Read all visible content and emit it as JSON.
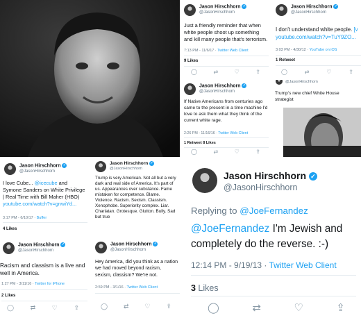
{
  "tweets": {
    "t1": {
      "name": "Jason Hirschhorn",
      "handle": "@JasonHirschhorn",
      "text": "Just a friendly reminder that when white people shoot up something and kill many people that's terrorism.",
      "time": "7:13 PM - 11/6/17 · ",
      "client": "Twitter Web Client",
      "stats": "9 Likes"
    },
    "t2": {
      "name": "Jason Hirschhorn",
      "handle": "@JasonHirschhorn",
      "text": "I don't understand white people. ",
      "link": "[v youtube.com/watch?v=TuY9ZO...",
      "time": "3:03 PM - 4/30/12 · ",
      "client": "YouTube on iOS",
      "stats": "1 Retweet"
    },
    "t3": {
      "name": "Jason Hirschhorn",
      "handle": "@JasonHirschhorn",
      "text": "If Native Americans from centuries ago came to the present in a time machine I'd love to ask them what they think of the current white rage.",
      "time": "2:26 PM - 11/16/16 · ",
      "client": "Twitter Web Client",
      "stats": "1 Retweet 8 Likes"
    },
    "t4": {
      "handle": "@JasonHirschhorn",
      "text": "Trump's new chief White House strategist"
    },
    "t5": {
      "name": "Jason Hirschhorn",
      "handle": "@JasonHirschhorn",
      "text_a": "I love Cube... ",
      "mention": "@icecube",
      "text_b": " and Symone Sanders on White Privilege | Real Time with Bill Maher (HBO) ",
      "link": "youtube.com/watch?v=gnwiYd...",
      "time": "3:17 PM - 6/10/17 · ",
      "client": "Buffer",
      "stats": "4 Likes"
    },
    "t6": {
      "name": "Jason Hirschhorn",
      "handle": "@JasonHirschhorn",
      "text": "Trump is very American. Not all but a very dark and real side of America. It's part of us. Appearances over substance. Fame mistaken for competence. Blame. Violence. Racism. Sexism. Classism. Xenophobe. Superiority complex. Liar. Charlatan. Grotesque. Glutton. Bully. Sad but true"
    },
    "t7": {
      "name": "Jason Hirschhorn",
      "handle": "@JasonHirschhorn",
      "text": "Racism and classism is a live and well in America.",
      "time": "1:27 PM - 3/11/16 · ",
      "client": "Twitter for iPhone",
      "stats": "2 Likes"
    },
    "t8": {
      "name": "Jason Hirschhorn",
      "handle": "@JasonHirschhorn",
      "text": "Hey America, did you think as a nation we had moved beyond racism, sexism, classism? We're not.",
      "time": "2:59 PM - 3/1/16 · ",
      "client": "Twitter Web Client"
    },
    "t9": {
      "name": "Jason Hirschhorn",
      "handle": "@JasonHirschhorn",
      "reply_label": "Replying to ",
      "reply_to": "@JoeFernandez",
      "mention": "@JoeFernandez",
      "text": " I'm Jewish and completely do the reverse. :-)",
      "time": "12:14 PM - 9/19/13 · ",
      "client": "Twitter Web Client",
      "likes_count": "3",
      "likes_label": " Likes"
    }
  },
  "icons": {
    "verified": "✓",
    "reply": "reply-icon",
    "retweet": "retweet-icon",
    "like": "heart-icon",
    "share": "share-icon"
  },
  "colors": {
    "link": "#1da1f2",
    "muted": "#657786",
    "border": "#e6ecf0"
  }
}
